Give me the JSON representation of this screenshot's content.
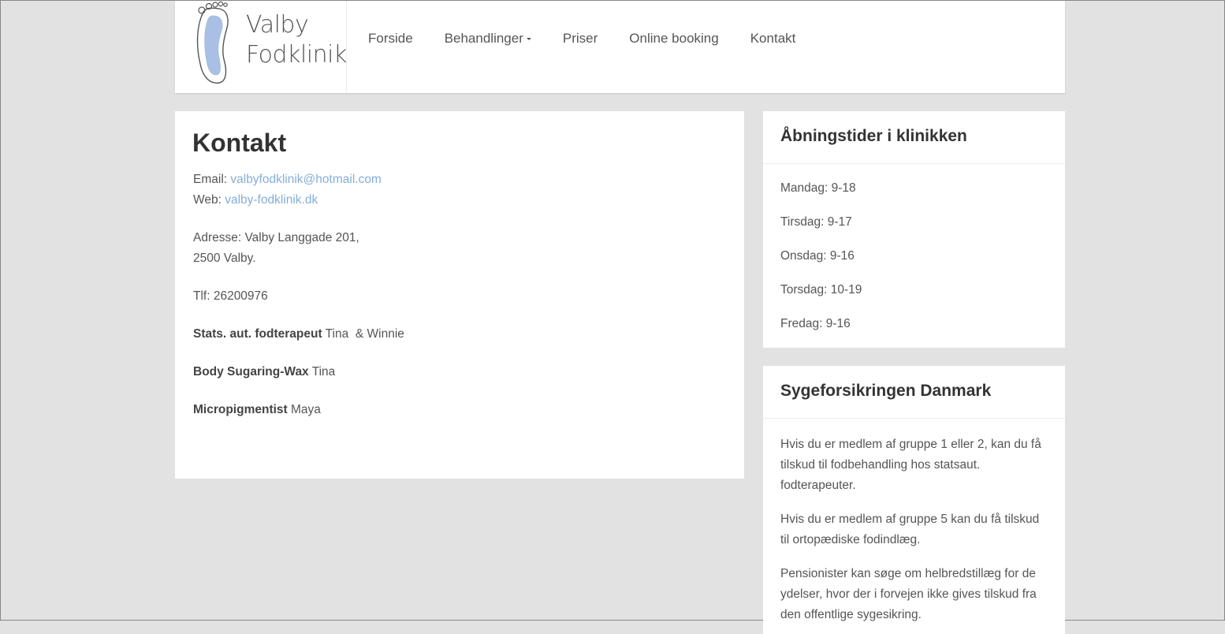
{
  "logo": {
    "line1": "Valby",
    "line2": "Fodklinik"
  },
  "nav": [
    {
      "label": "Forside"
    },
    {
      "label": "Behandlinger"
    },
    {
      "label": "Priser"
    },
    {
      "label": "Online booking"
    },
    {
      "label": "Kontakt"
    }
  ],
  "main": {
    "title": "Kontakt",
    "email_label": "Email: ",
    "email_value": "valbyfodklinik@hotmail.com",
    "web_label": "Web: ",
    "web_value": "valby-fodklinik.dk",
    "address_line1": "Adresse: Valby Langgade 201,",
    "address_line2": "2500 Valby.",
    "phone": "Tlf: 26200976",
    "staff": [
      {
        "role": "Stats. aut. fodterapeut",
        "names": " Tina  & Winnie"
      },
      {
        "role": "Body Sugaring-Wax",
        "names": " Tina"
      },
      {
        "role": "Micropigmentist",
        "names": " Maya"
      }
    ]
  },
  "hours": {
    "title": "Åbningstider i klinikken",
    "items": [
      "Mandag: 9-18",
      "Tirsdag: 9-17",
      "Onsdag: 9-16",
      "Torsdag: 10-19",
      "Fredag: 9-16"
    ]
  },
  "insurance": {
    "title": "Sygeforsikringen Danmark",
    "paragraphs": [
      "Hvis du er medlem af gruppe 1 eller 2, kan du få tilskud til fodbehandling hos statsaut. fodterapeuter.",
      "Hvis du er medlem af gruppe 5 kan du få tilskud til ortopædiske fodindlæg.",
      "Pensionister kan søge om helbredstillæg for de ydelser, hvor der i forvejen ikke gives tilskud fra den offentlige sygesikring."
    ]
  },
  "colors": {
    "link": "#86aed8",
    "foot_fill": "#a9bfe3",
    "background": "#e2e2e2"
  }
}
